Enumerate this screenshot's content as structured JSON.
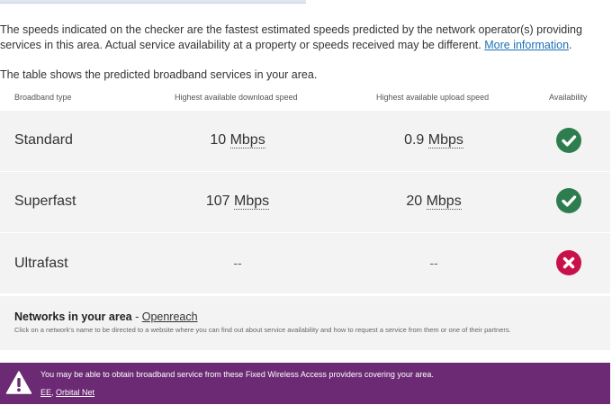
{
  "intro": {
    "text": "The speeds indicated on the checker are the fastest estimated speeds predicted by the network operator(s) providing services in this area. Actual service availability at a property or speeds received may be different.",
    "link": "More information",
    "after_link": "."
  },
  "table_intro": "The table shows the predicted broadband services in your area.",
  "table": {
    "headers": {
      "type": "Broadband type",
      "download": "Highest available download speed",
      "upload": "Highest available upload speed",
      "availability": "Availability"
    },
    "rows": [
      {
        "type": "Standard",
        "download_value": "10",
        "download_unit": "Mbps",
        "upload_value": "0.9",
        "upload_unit": "Mbps",
        "available": true,
        "icon": "check-icon"
      },
      {
        "type": "Superfast",
        "download_value": "107",
        "download_unit": "Mbps",
        "upload_value": "20",
        "upload_unit": "Mbps",
        "available": true,
        "icon": "check-icon"
      },
      {
        "type": "Ultrafast",
        "download_value": "--",
        "download_unit": "",
        "upload_value": "--",
        "upload_unit": "",
        "available": false,
        "icon": "cross-icon"
      }
    ]
  },
  "networks": {
    "label": "Networks in your area",
    "separator": " - ",
    "link": "Openreach",
    "note": "Click on a network's name to be directed to a website where you can find out about service availability and how to request a service from them or one of their partners."
  },
  "fwa": {
    "icon": "warning-icon",
    "message": "You may be able to obtain broadband service from these Fixed Wireless Access providers covering your area.",
    "providers": [
      "EE",
      "Orbital Net"
    ],
    "provider_separator": ", "
  },
  "colors": {
    "available": "#2e7d4f",
    "unavailable": "#c8114b",
    "banner": "#6b2a73",
    "row_bg": "#f3f3f3",
    "link": "#1d70b8"
  }
}
